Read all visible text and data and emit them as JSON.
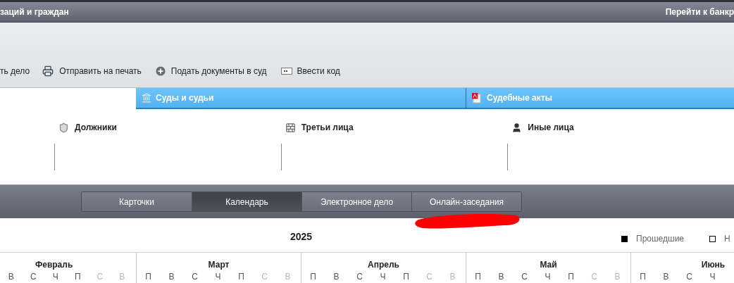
{
  "header": {
    "left_text": "заций и граждан",
    "right_link": "Перейти к банкр"
  },
  "toolbar": [
    {
      "label": "ть дело",
      "kind": "text"
    },
    {
      "label": "Отправить на печать",
      "kind": "print"
    },
    {
      "label": "Подать документы в суд",
      "kind": "submit"
    },
    {
      "label": "Ввести код",
      "kind": "code"
    }
  ],
  "sections": [
    {
      "label": "Суды и судьи",
      "kind": "courts"
    },
    {
      "label": "Судебные акты",
      "kind": "acts"
    }
  ],
  "parties": [
    {
      "label": "Должники",
      "kind": "debtors"
    },
    {
      "label": "Третьи лица",
      "kind": "third"
    },
    {
      "label": "Иные лица",
      "kind": "others"
    }
  ],
  "view_tabs": [
    {
      "label": "Карточки",
      "selected": false
    },
    {
      "label": "Календарь",
      "selected": true
    },
    {
      "label": "Электронное дело",
      "selected": false
    },
    {
      "label": "Онлайн-заседания",
      "selected": false
    }
  ],
  "year": "2025",
  "legend": [
    {
      "label": "Прошедшие",
      "filled": true
    },
    {
      "label": "Н",
      "filled": false
    }
  ],
  "months": [
    {
      "name": "Февраль",
      "days": [
        {
          "label": "В",
          "weekend": false
        },
        {
          "label": "С",
          "weekend": false
        },
        {
          "label": "Ч",
          "weekend": false
        },
        {
          "label": "П",
          "weekend": false
        },
        {
          "label": "С",
          "weekend": true
        },
        {
          "label": "В",
          "weekend": true
        }
      ]
    },
    {
      "name": "Март",
      "days": [
        {
          "label": "П",
          "weekend": false
        },
        {
          "label": "В",
          "weekend": false
        },
        {
          "label": "С",
          "weekend": false
        },
        {
          "label": "Ч",
          "weekend": false
        },
        {
          "label": "П",
          "weekend": false
        },
        {
          "label": "С",
          "weekend": true
        },
        {
          "label": "В",
          "weekend": true
        }
      ]
    },
    {
      "name": "Апрель",
      "days": [
        {
          "label": "П",
          "weekend": false
        },
        {
          "label": "В",
          "weekend": false
        },
        {
          "label": "С",
          "weekend": false
        },
        {
          "label": "Ч",
          "weekend": false
        },
        {
          "label": "П",
          "weekend": false
        },
        {
          "label": "С",
          "weekend": true
        },
        {
          "label": "В",
          "weekend": true
        }
      ]
    },
    {
      "name": "Май",
      "days": [
        {
          "label": "П",
          "weekend": false
        },
        {
          "label": "В",
          "weekend": false
        },
        {
          "label": "С",
          "weekend": false
        },
        {
          "label": "Ч",
          "weekend": false
        },
        {
          "label": "П",
          "weekend": false
        },
        {
          "label": "С",
          "weekend": true
        },
        {
          "label": "В",
          "weekend": true
        }
      ]
    },
    {
      "name": "Июнь",
      "days": [
        {
          "label": "П",
          "weekend": false
        },
        {
          "label": "В",
          "weekend": false
        },
        {
          "label": "С",
          "weekend": false
        },
        {
          "label": "Ч",
          "weekend": false
        }
      ]
    }
  ]
}
